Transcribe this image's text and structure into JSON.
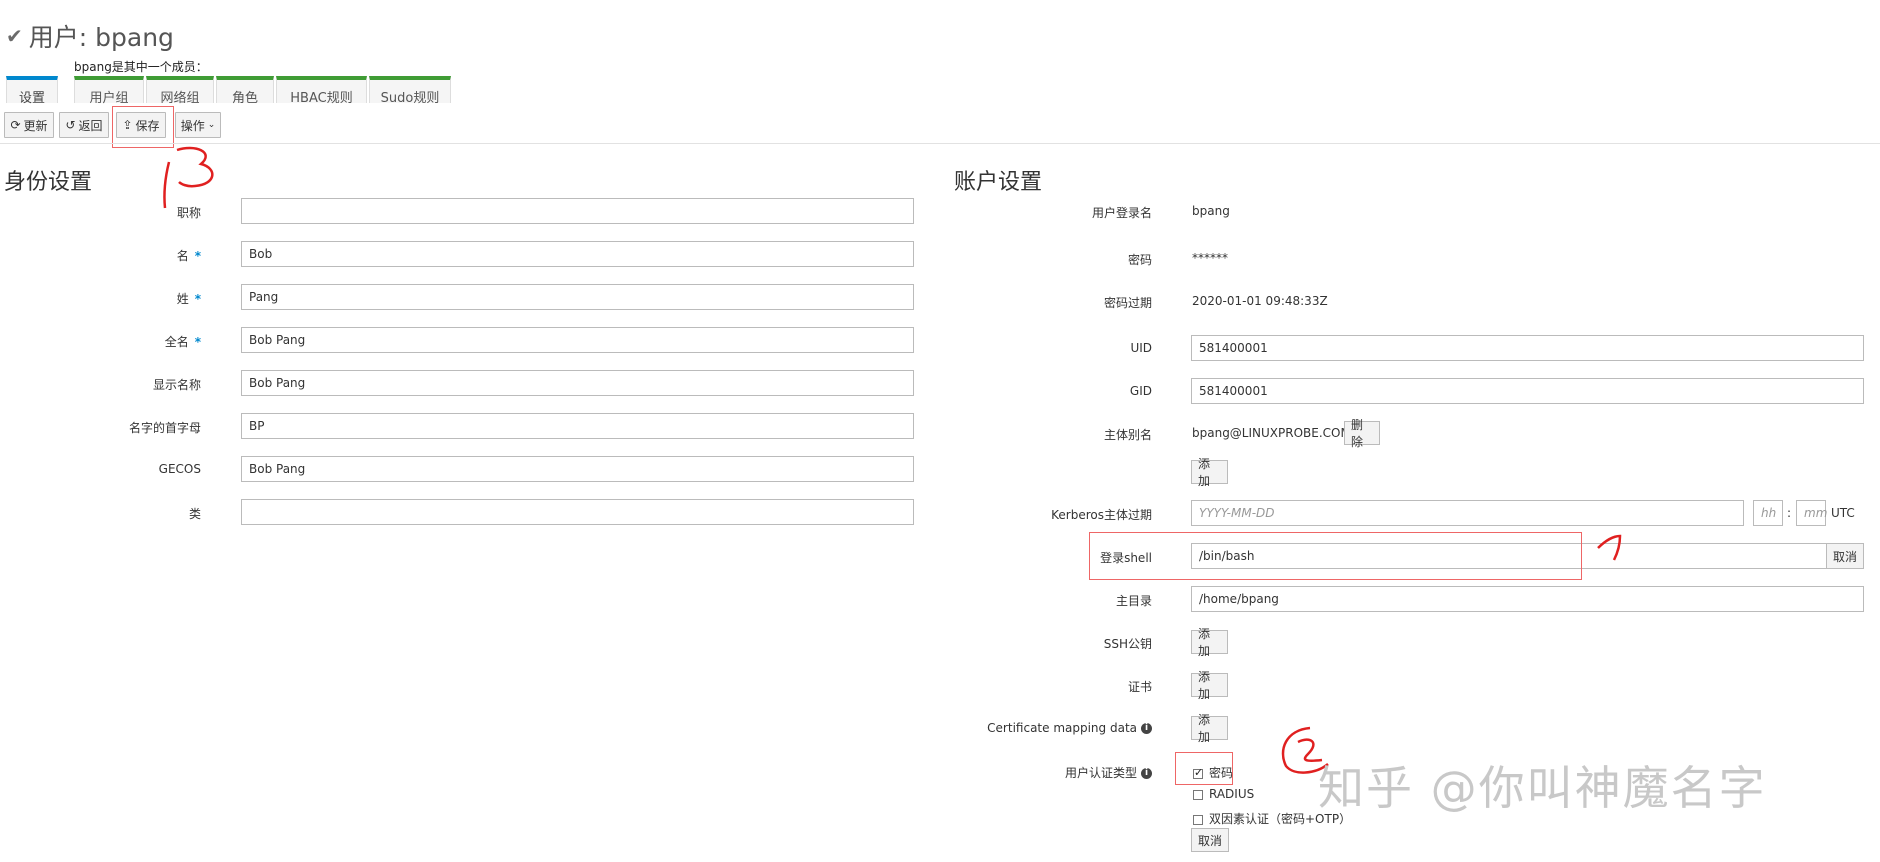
{
  "header": {
    "title": "用户: bpang"
  },
  "tabs": {
    "settings": "设置",
    "member_label": "bpang是其中一个成员：",
    "items": [
      "用户组",
      "网络组",
      "角色",
      "HBAC规则",
      "Sudo规则"
    ]
  },
  "toolbar": {
    "refresh": "更新",
    "revert": "返回",
    "save": "保存",
    "actions": "操作"
  },
  "identity": {
    "title": "身份设置",
    "fields": [
      {
        "label": "职称",
        "value": "",
        "required": false
      },
      {
        "label": "名",
        "value": "Bob",
        "required": true
      },
      {
        "label": "姓",
        "value": "Pang",
        "required": true
      },
      {
        "label": "全名",
        "value": "Bob Pang",
        "required": true
      },
      {
        "label": "显示名称",
        "value": "Bob Pang",
        "required": false
      },
      {
        "label": "名字的首字母",
        "value": "BP",
        "required": false
      },
      {
        "label": "GECOS",
        "value": "Bob Pang",
        "required": false
      },
      {
        "label": "类",
        "value": "",
        "required": false
      }
    ]
  },
  "account": {
    "title": "账户设置",
    "login_label": "用户登录名",
    "login_value": "bpang",
    "password_label": "密码",
    "password_value": "******",
    "expire_label": "密码过期",
    "expire_value": "2020-01-01 09:48:33Z",
    "uid_label": "UID",
    "uid_value": "581400001",
    "gid_label": "GID",
    "gid_value": "581400001",
    "principal_label": "主体别名",
    "principal_value": "bpang@LINUXPROBE.COM",
    "delete_label": "删除",
    "add_label": "添加",
    "krb_label": "Kerberos主体过期",
    "krb_date_placeholder": "YYYY-MM-DD",
    "krb_hh_placeholder": "hh",
    "krb_mm_placeholder": "mm",
    "krb_colon": ":",
    "krb_utc": "UTC",
    "shell_label": "登录shell",
    "shell_value": "/bin/bash",
    "cancel_label": "取消",
    "home_label": "主目录",
    "home_value": "/home/bpang",
    "ssh_label": "SSH公钥",
    "cert_label": "证书",
    "certmap_label": "Certificate mapping data",
    "auth_label": "用户认证类型",
    "auth_options": [
      {
        "label": "密码",
        "checked": true
      },
      {
        "label": "RADIUS",
        "checked": false
      },
      {
        "label": "双因素认证（密码+OTP）",
        "checked": false
      }
    ]
  },
  "annotations": {
    "one": "1",
    "two": "2",
    "three": "3"
  },
  "watermark": "知乎 @你叫神魔名字"
}
